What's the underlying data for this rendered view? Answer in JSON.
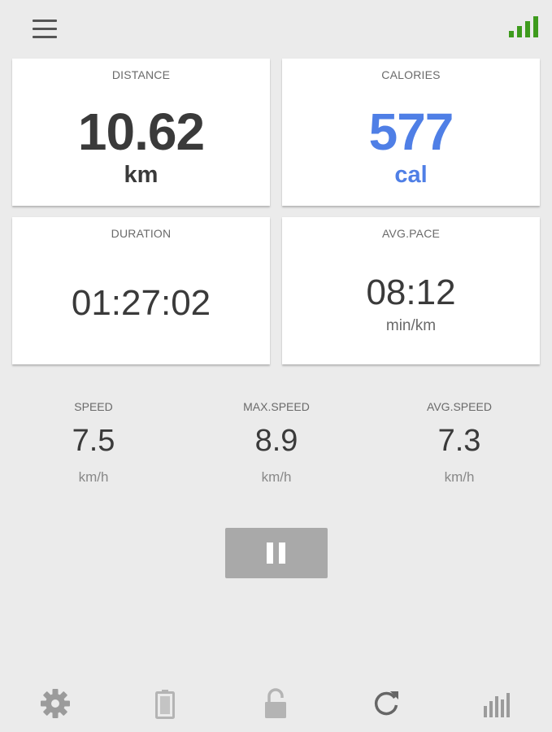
{
  "header": {
    "menu_icon": "hamburger-menu-icon",
    "signal_icon": "gps-signal-icon",
    "signal_color": "#3e9b1d"
  },
  "cards": {
    "distance": {
      "label": "DISTANCE",
      "value": "10.62",
      "unit": "km",
      "color": "#3a3a3a"
    },
    "calories": {
      "label": "CALORIES",
      "value": "577",
      "unit": "cal",
      "color": "#4f7fe6"
    },
    "duration": {
      "label": "DURATION",
      "value": "01:27:02"
    },
    "avg_pace": {
      "label": "AVG.PACE",
      "value": "08:12",
      "unit": "min/km"
    }
  },
  "stats": {
    "speed": {
      "label": "SPEED",
      "value": "7.5",
      "unit": "km/h"
    },
    "max_speed": {
      "label": "MAX.SPEED",
      "value": "8.9",
      "unit": "km/h"
    },
    "avg_speed": {
      "label": "AVG.SPEED",
      "value": "7.3",
      "unit": "km/h"
    }
  },
  "controls": {
    "pause_icon": "pause-icon"
  },
  "bottom_nav": [
    {
      "icon": "gear-icon"
    },
    {
      "icon": "battery-icon"
    },
    {
      "icon": "lock-icon"
    },
    {
      "icon": "refresh-icon"
    },
    {
      "icon": "bar-chart-icon"
    }
  ]
}
